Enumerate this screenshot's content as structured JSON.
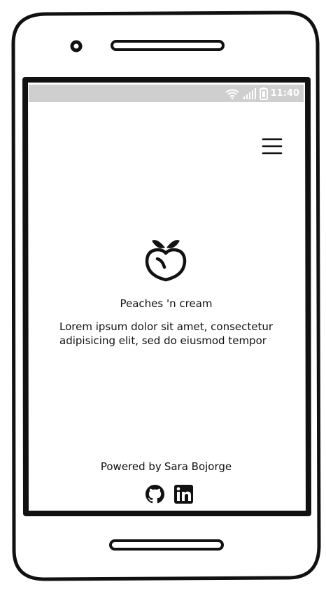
{
  "status_bar": {
    "time": "11:40",
    "icons": [
      "wifi-icon",
      "signal-icon",
      "battery-icon"
    ]
  },
  "header": {
    "menu_icon": "hamburger-menu-icon"
  },
  "main": {
    "logo_icon": "peach-icon",
    "title": "Peaches 'n cream",
    "description": "Lorem ipsum dolor sit amet, consectetur adipisicing elit, sed do eiusmod tempor"
  },
  "footer": {
    "powered_by": "Powered by",
    "author": "Sara Bojorge",
    "social": [
      {
        "icon": "github-icon"
      },
      {
        "icon": "linkedin-icon"
      }
    ]
  },
  "colors": {
    "status_bar_bg": "#cfcfcf",
    "stroke": "#111111",
    "background": "#ffffff"
  }
}
